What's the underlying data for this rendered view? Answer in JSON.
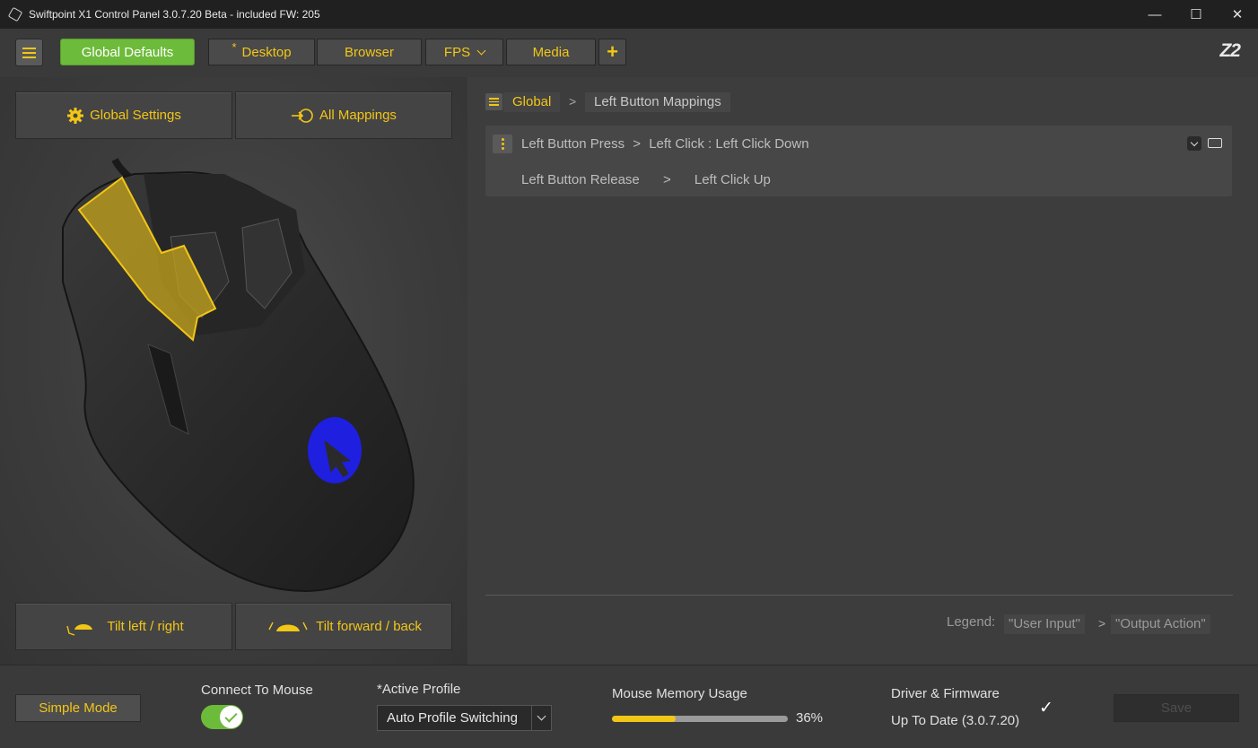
{
  "window": {
    "title": "Swiftpoint X1 Control Panel 3.0.7.20 Beta - included FW: 205",
    "minimize": "—",
    "maximize": "☐",
    "close": "✕"
  },
  "toolbar": {
    "tabs": [
      {
        "label": "Global Defaults",
        "active": true
      },
      {
        "label": "Desktop",
        "modified_marker": "*"
      },
      {
        "label": "Browser"
      },
      {
        "label": "FPS",
        "has_dropdown": true
      },
      {
        "label": "Media"
      }
    ],
    "add_label": "+",
    "logo": "Z2"
  },
  "left_panel": {
    "global_settings": "Global Settings",
    "all_mappings": "All Mappings",
    "tilt_left_right": "Tilt left / right",
    "tilt_forward_back": "Tilt forward / back"
  },
  "breadcrumb": {
    "root": "Global",
    "current": "Left Button Mappings"
  },
  "mapping": {
    "press_input": "Left Button Press",
    "press_output": "Left Click : Left Click Down",
    "release_input": "Left Button Release",
    "release_output": "Left Click Up"
  },
  "legend": {
    "label": "Legend:",
    "input": "\"User Input\"",
    "output": "\"Output Action\""
  },
  "bottom": {
    "simple_mode": "Simple Mode",
    "connect_label": "Connect To Mouse",
    "connect_on": true,
    "profile_label": "*Active Profile",
    "profile_value": "Auto Profile Switching",
    "memory_label": "Mouse Memory Usage",
    "memory_value": "36%",
    "memory_fraction": 0.36,
    "driver_label": "Driver & Firmware",
    "driver_status": "Up To Date (3.0.7.20)",
    "save": "Save"
  },
  "colors": {
    "accent": "#f2c616",
    "active_tab": "#6dbb3a",
    "highlight_button": "#1f1fe0"
  }
}
